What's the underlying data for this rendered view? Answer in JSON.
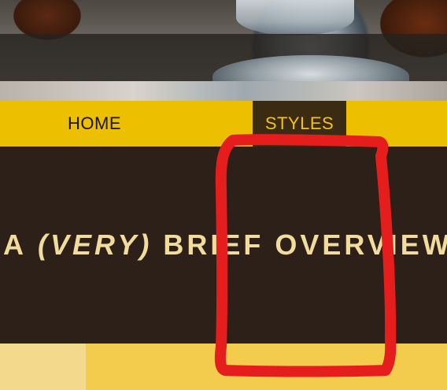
{
  "nav": {
    "items": [
      {
        "label": "HOME",
        "active": false
      },
      {
        "label": "STYLES",
        "active": true
      }
    ]
  },
  "overview": {
    "title_prefix": "A",
    "title_emphasis": "(VERY)",
    "title_suffix": "BRIEF OVERVIEW"
  },
  "colors": {
    "nav_background": "#ecbf00",
    "nav_active_background": "#3b2b13",
    "nav_active_text": "#f1c21c",
    "section_background": "#2c2018",
    "title_text": "#f1dc9e",
    "swatch_light": "#f2d98c",
    "swatch_gold": "#f3cc4d",
    "annotation": "#e51d1d"
  }
}
